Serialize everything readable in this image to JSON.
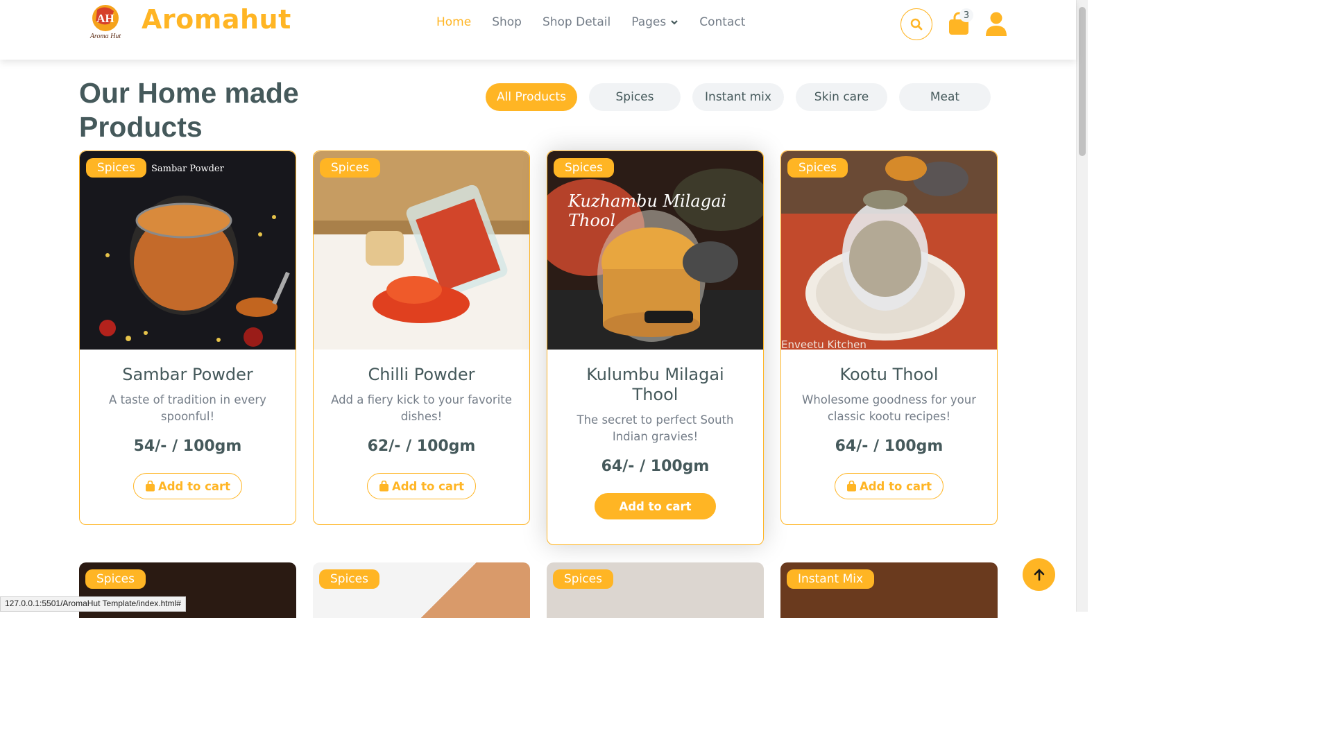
{
  "brand": {
    "name": "Aromahut",
    "logo_text": "AH",
    "logo_subtext": "Aroma Hut"
  },
  "nav": {
    "items": [
      {
        "label": "Home",
        "active": true
      },
      {
        "label": "Shop"
      },
      {
        "label": "Shop Detail"
      },
      {
        "label": "Pages",
        "has_dropdown": true
      },
      {
        "label": "Contact"
      }
    ],
    "cart_count": "3",
    "icons": [
      "search-icon",
      "shopping-bag-icon",
      "user-icon"
    ]
  },
  "section": {
    "title": "Our Home made Products"
  },
  "tabs": [
    "All Products",
    "Spices",
    "Instant mix",
    "Skin care",
    "Meat"
  ],
  "products": [
    {
      "badge": "Spices",
      "name": "Sambar Powder",
      "description": "A taste of tradition in every spoonful!",
      "price": "54/- / 100gm",
      "button": "Add to cart",
      "image_caption": "Sambar Powder"
    },
    {
      "badge": "Spices",
      "name": "Chilli Powder",
      "description": "Add a fiery kick to your favorite dishes!",
      "price": "62/- / 100gm",
      "button": "Add to cart"
    },
    {
      "badge": "Spices",
      "name": "Kulumbu Milagai Thool",
      "description": "The secret to perfect South Indian gravies!",
      "price": "64/- / 100gm",
      "button": "Add to cart",
      "image_caption": "Kuzhambu Milagai Thool"
    },
    {
      "badge": "Spices",
      "name": "Kootu Thool",
      "description": "Wholesome goodness for your classic kootu recipes!",
      "price": "64/- / 100gm",
      "button": "Add to cart",
      "image_caption": "Enveetu Kitchen"
    }
  ],
  "second_row_badges": [
    "Spices",
    "Spices",
    "Spices",
    "Instant Mix"
  ],
  "status_url": "127.0.0.1:5501/AromaHut Template/index.html#",
  "colors": {
    "accent": "#ffb524",
    "text": "#45595b",
    "muted": "#747d88"
  }
}
